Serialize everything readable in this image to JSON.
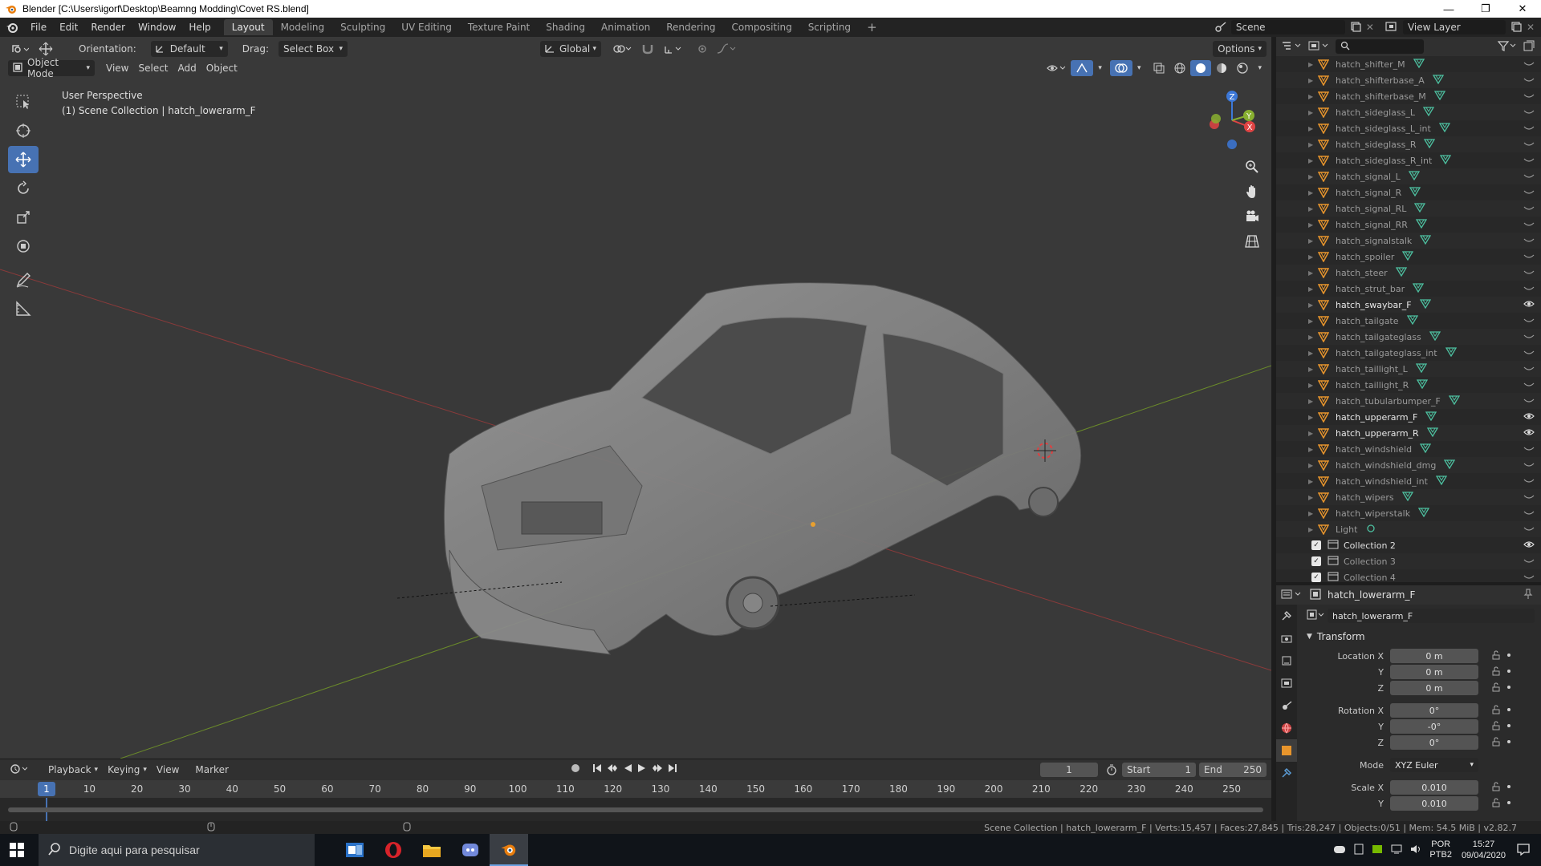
{
  "window": {
    "title": "Blender [C:\\Users\\igorf\\Desktop\\Beamng Modding\\Covet RS.blend]",
    "controls": [
      "—",
      "❐",
      "✕"
    ]
  },
  "menu": [
    "File",
    "Edit",
    "Render",
    "Window",
    "Help"
  ],
  "workspaces": {
    "tabs": [
      "Layout",
      "Modeling",
      "Sculpting",
      "UV Editing",
      "Texture Paint",
      "Shading",
      "Animation",
      "Rendering",
      "Compositing",
      "Scripting"
    ],
    "add": "+"
  },
  "scene": {
    "scene_name": "Scene",
    "view_layer": "View Layer"
  },
  "tool_header": {
    "orientation_label": "Orientation:",
    "orientation_value": "Default",
    "drag_label": "Drag:",
    "drag_value": "Select Box",
    "transform_orientation": "Global",
    "options": "Options"
  },
  "viewport_header": {
    "mode": "Object Mode",
    "menus": [
      "View",
      "Select",
      "Add",
      "Object"
    ]
  },
  "viewport": {
    "perspective": "User Perspective",
    "collection_info": "(1) Scene Collection | hatch_lowerarm_F",
    "gizmo": {
      "z": "Z",
      "y": "Y",
      "x": "X"
    }
  },
  "timeline": {
    "menus": [
      "Playback",
      "Keying",
      "View",
      "Marker"
    ],
    "current_frame": "1",
    "start_label": "Start",
    "start": "1",
    "end_label": "End",
    "end": "250",
    "ticks": [
      "10",
      "20",
      "30",
      "40",
      "50",
      "60",
      "70",
      "80",
      "90",
      "100",
      "110",
      "120",
      "130",
      "140",
      "150",
      "160",
      "170",
      "180",
      "190",
      "200",
      "210",
      "220",
      "230",
      "240",
      "250"
    ],
    "cursor_label": "1"
  },
  "outliner": {
    "items": [
      {
        "name": "hatch_shifter_M",
        "visible": false
      },
      {
        "name": "hatch_shifterbase_A",
        "visible": false
      },
      {
        "name": "hatch_shifterbase_M",
        "visible": false
      },
      {
        "name": "hatch_sideglass_L",
        "visible": false
      },
      {
        "name": "hatch_sideglass_L_int",
        "visible": false
      },
      {
        "name": "hatch_sideglass_R",
        "visible": false
      },
      {
        "name": "hatch_sideglass_R_int",
        "visible": false
      },
      {
        "name": "hatch_signal_L",
        "visible": false
      },
      {
        "name": "hatch_signal_R",
        "visible": false
      },
      {
        "name": "hatch_signal_RL",
        "visible": false
      },
      {
        "name": "hatch_signal_RR",
        "visible": false
      },
      {
        "name": "hatch_signalstalk",
        "visible": false
      },
      {
        "name": "hatch_spoiler",
        "visible": false
      },
      {
        "name": "hatch_steer",
        "visible": false
      },
      {
        "name": "hatch_strut_bar",
        "visible": false
      },
      {
        "name": "hatch_swaybar_F",
        "visible": true
      },
      {
        "name": "hatch_tailgate",
        "visible": false
      },
      {
        "name": "hatch_tailgateglass",
        "visible": false
      },
      {
        "name": "hatch_tailgateglass_int",
        "visible": false
      },
      {
        "name": "hatch_taillight_L",
        "visible": false
      },
      {
        "name": "hatch_taillight_R",
        "visible": false
      },
      {
        "name": "hatch_tubularbumper_F",
        "visible": false
      },
      {
        "name": "hatch_upperarm_F",
        "visible": true
      },
      {
        "name": "hatch_upperarm_R",
        "visible": true
      },
      {
        "name": "hatch_windshield",
        "visible": false
      },
      {
        "name": "hatch_windshield_dmg",
        "visible": false
      },
      {
        "name": "hatch_windshield_int",
        "visible": false
      },
      {
        "name": "hatch_wipers",
        "visible": false
      },
      {
        "name": "hatch_wiperstalk",
        "visible": false
      },
      {
        "name": "Light",
        "visible": false
      }
    ],
    "collections": [
      {
        "name": "Collection 2",
        "visible": true
      },
      {
        "name": "Collection 3",
        "visible": false
      },
      {
        "name": "Collection 4",
        "visible": false
      }
    ]
  },
  "properties": {
    "object_name": "hatch_lowerarm_F",
    "object_field": "hatch_lowerarm_F",
    "section": "Transform",
    "rows": [
      {
        "label": "Location X",
        "value": "0 m"
      },
      {
        "label": "Y",
        "value": "0 m"
      },
      {
        "label": "Z",
        "value": "0 m"
      },
      {
        "label": "Rotation X",
        "value": "0°"
      },
      {
        "label": "Y",
        "value": "-0°"
      },
      {
        "label": "Z",
        "value": "0°"
      }
    ],
    "mode_label": "Mode",
    "mode_value": "XYZ Euler",
    "scale_rows": [
      {
        "label": "Scale X",
        "value": "0.010"
      },
      {
        "label": "Y",
        "value": "0.010"
      }
    ]
  },
  "statusbar": {
    "text": "Scene Collection | hatch_lowerarm_F | Verts:15,457 | Faces:27,845 | Tris:28,247 | Objects:0/51 | Mem: 54.5 MiB | v2.82.7"
  },
  "taskbar": {
    "search_placeholder": "Digite aqui para pesquisar",
    "lang": "POR",
    "kbd": "PTB2",
    "time": "15:27",
    "date": "09/04/2020"
  }
}
